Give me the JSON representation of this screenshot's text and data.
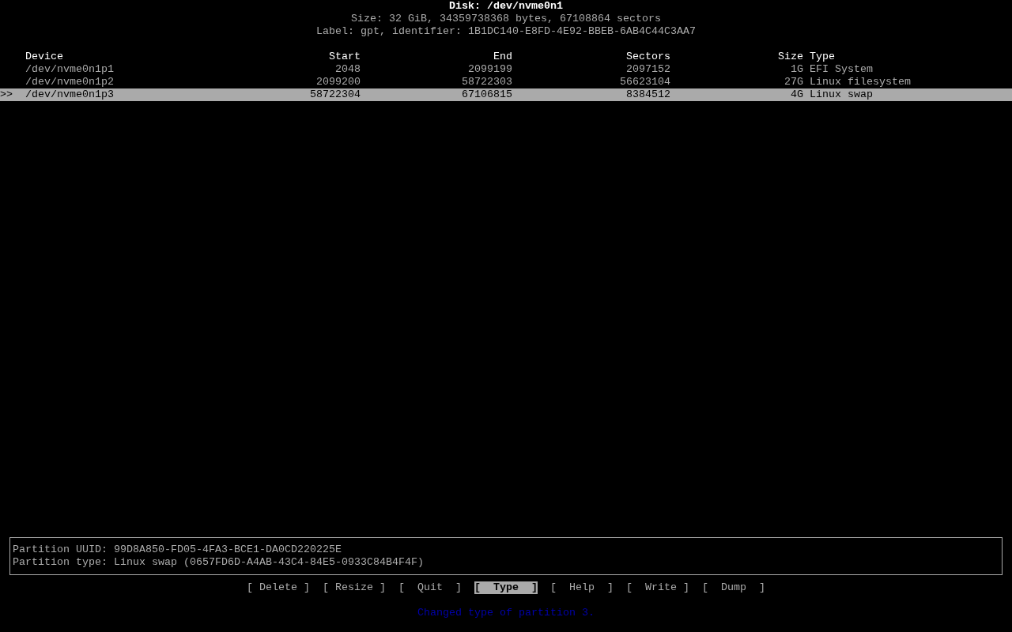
{
  "disk": {
    "title": "Disk: /dev/nvme0n1",
    "size_line": "Size: 32 GiB, 34359738368 bytes, 67108864 sectors",
    "label_line": "Label: gpt, identifier: 1B1DC140-E8FD-4E92-BBEB-6AB4C44C3AA7"
  },
  "table": {
    "cursor_marker": ">>",
    "columns": [
      "Device",
      "Start",
      "End",
      "Sectors",
      "Size",
      "Type"
    ],
    "rows": [
      {
        "cells": [
          "/dev/nvme0n1p1",
          "2048",
          "2099199",
          "2097152",
          "1G",
          "EFI System"
        ],
        "selected": false
      },
      {
        "cells": [
          "/dev/nvme0n1p2",
          "2099200",
          "58722303",
          "56623104",
          "27G",
          "Linux filesystem"
        ],
        "selected": false
      },
      {
        "cells": [
          "/dev/nvme0n1p3",
          "58722304",
          "67106815",
          "8384512",
          "4G",
          "Linux swap"
        ],
        "selected": true
      }
    ]
  },
  "info_panel": [
    "Partition UUID: 99D8A850-FD05-4FA3-BCE1-DA0CD220225E",
    "Partition type: Linux swap (0657FD6D-A4AB-43C4-84E5-0933C84B4F4F)"
  ],
  "buttons": [
    {
      "label": "[ Delete ]",
      "selected": false
    },
    {
      "label": "[ Resize ]",
      "selected": false
    },
    {
      "label": "[  Quit  ]",
      "selected": false
    },
    {
      "label": "[  Type  ]",
      "selected": true
    },
    {
      "label": "[  Help  ]",
      "selected": false
    },
    {
      "label": "[  Write ]",
      "selected": false
    },
    {
      "label": "[  Dump  ]",
      "selected": false
    }
  ],
  "status_message": "Changed type of partition 3."
}
